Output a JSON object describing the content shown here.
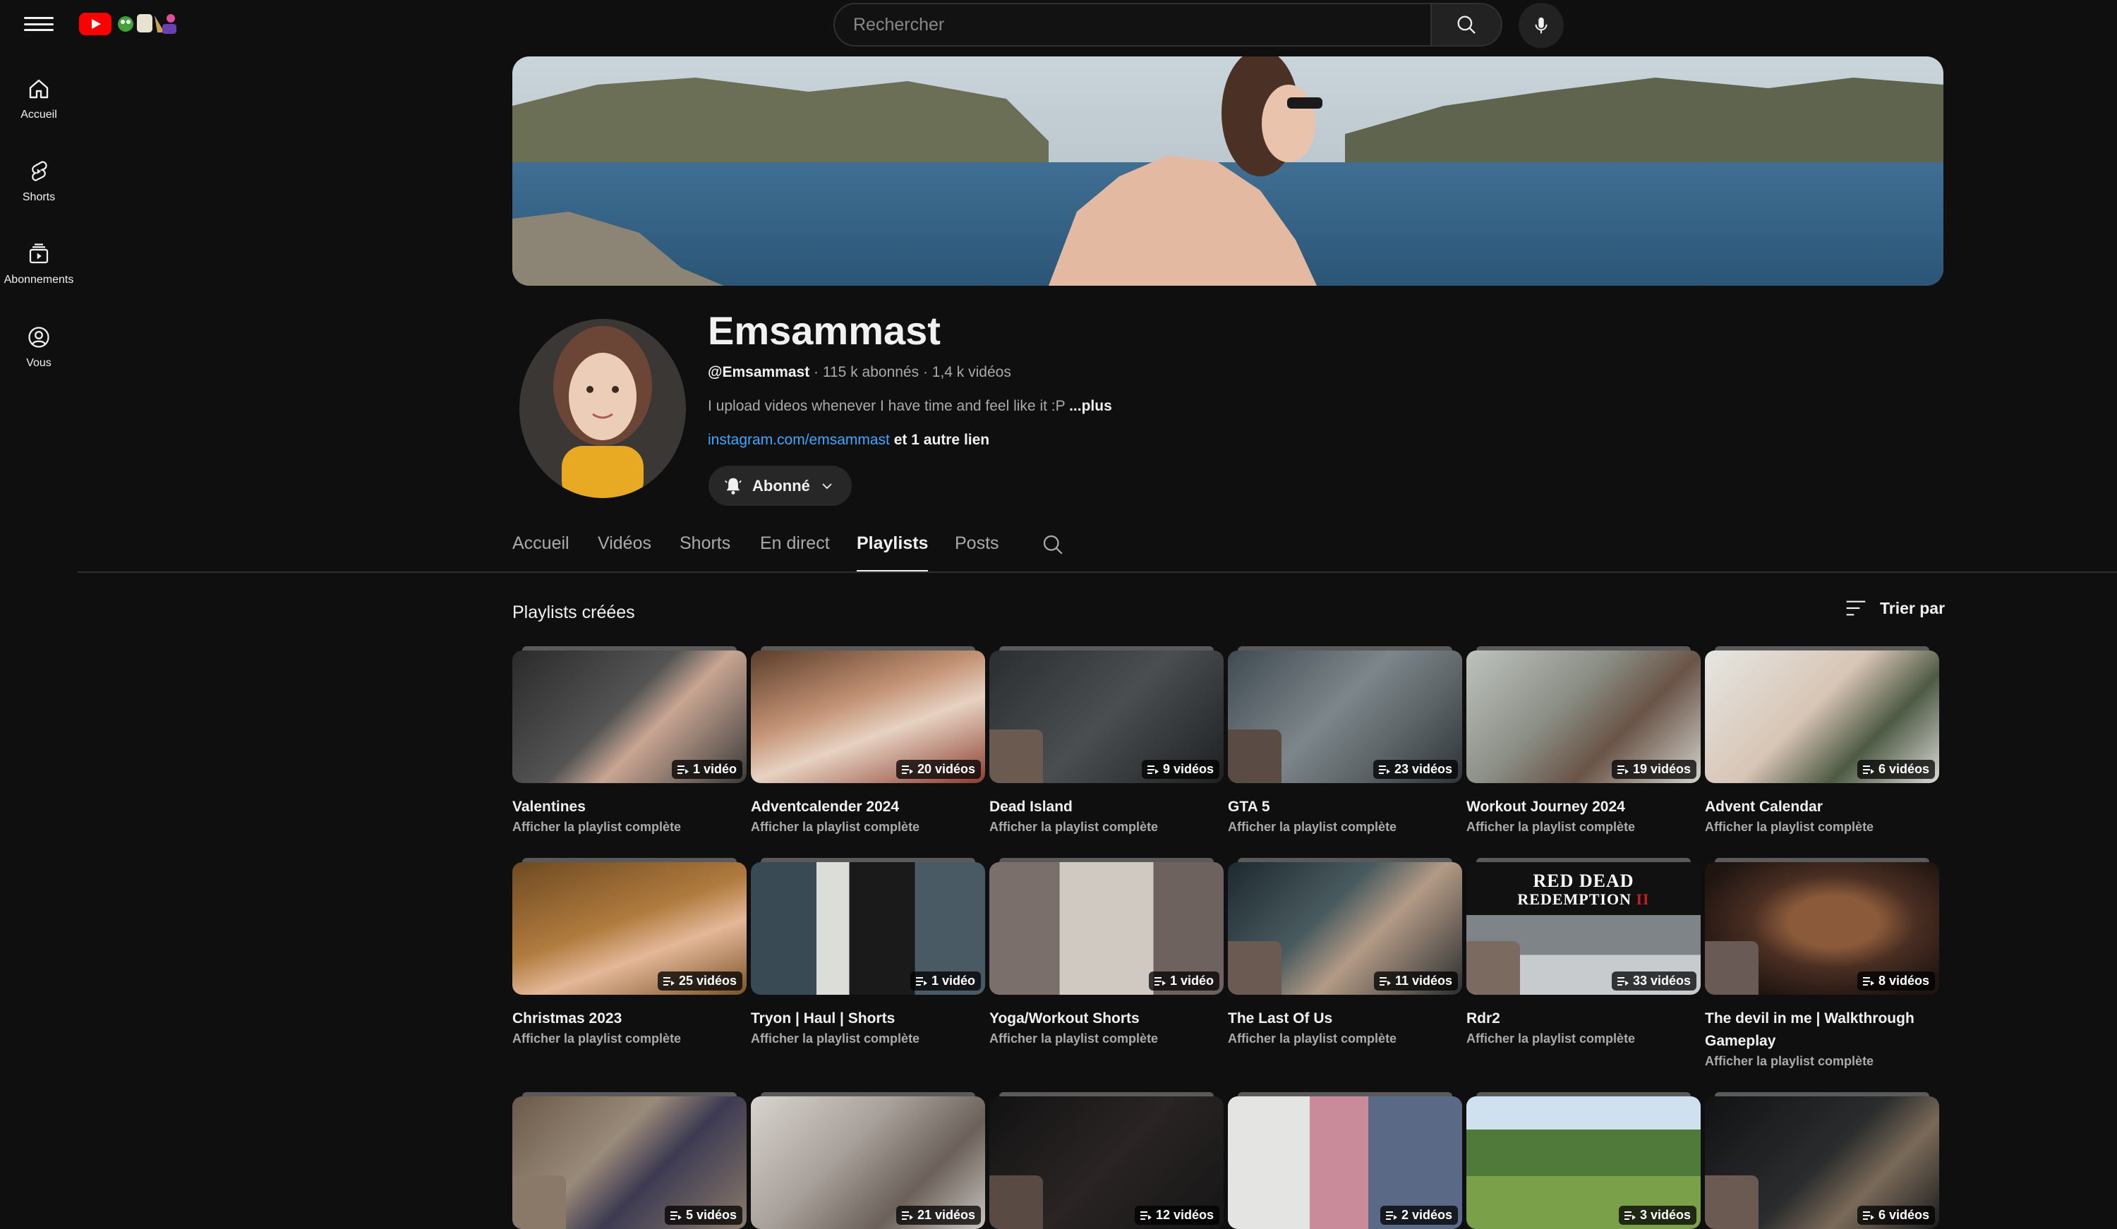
{
  "topbar": {
    "search_placeholder": "Rechercher"
  },
  "sidebar": {
    "items": [
      {
        "label": "Accueil",
        "icon": "home-icon"
      },
      {
        "label": "Shorts",
        "icon": "shorts-icon"
      },
      {
        "label": "Abonnements",
        "icon": "subscriptions-icon"
      },
      {
        "label": "Vous",
        "icon": "account-icon"
      }
    ]
  },
  "channel": {
    "name": "Emsammast",
    "handle": "@Emsammast",
    "stats": " · 115 k abonnés · 1,4 k vidéos",
    "description": "I upload videos whenever I have time and feel like it :P ",
    "more_label": "...plus",
    "link": "instagram.com/emsammast",
    "other_links": " et 1 autre lien",
    "subscribe_label": "Abonné"
  },
  "tabs": [
    {
      "label": "Accueil",
      "active": false
    },
    {
      "label": "Vidéos",
      "active": false
    },
    {
      "label": "Shorts",
      "active": false
    },
    {
      "label": "En direct",
      "active": false
    },
    {
      "label": "Playlists",
      "active": true
    },
    {
      "label": "Posts",
      "active": false
    }
  ],
  "section": {
    "title": "Playlists créées",
    "sort_label": "Trier par"
  },
  "playlists": [
    {
      "title": "Valentines",
      "count": "1 vidéo",
      "sub": "Afficher la playlist complète"
    },
    {
      "title": "Adventcalender 2024",
      "count": "20 vidéos",
      "sub": "Afficher la playlist complète"
    },
    {
      "title": "Dead Island",
      "count": "9 vidéos",
      "sub": "Afficher la playlist complète"
    },
    {
      "title": "GTA 5",
      "count": "23 vidéos",
      "sub": "Afficher la playlist complète"
    },
    {
      "title": "Workout Journey 2024",
      "count": "19 vidéos",
      "sub": "Afficher la playlist complète"
    },
    {
      "title": "Advent Calendar",
      "count": "6 vidéos",
      "sub": "Afficher la playlist complète"
    },
    {
      "title": "Christmas 2023",
      "count": "25 vidéos",
      "sub": "Afficher la playlist complète"
    },
    {
      "title": "Tryon | Haul | Shorts",
      "count": "1 vidéo",
      "sub": "Afficher la playlist complète"
    },
    {
      "title": "Yoga/Workout Shorts",
      "count": "1 vidéo",
      "sub": "Afficher la playlist complète"
    },
    {
      "title": "The Last Of Us",
      "count": "11 vidéos",
      "sub": "Afficher la playlist complète"
    },
    {
      "title": "Rdr2",
      "count": "33 vidéos",
      "sub": "Afficher la playlist complète",
      "thumb_text_1": "RED DEAD",
      "thumb_text_2": "REDEMPTION",
      "thumb_text_3": "II"
    },
    {
      "title": "The devil in me | Walkthrough Gameplay",
      "count": "8 vidéos",
      "sub": "Afficher la playlist complète"
    },
    {
      "title": "",
      "count": "5 vidéos",
      "sub": ""
    },
    {
      "title": "",
      "count": "21 vidéos",
      "sub": ""
    },
    {
      "title": "",
      "count": "12 vidéos",
      "sub": ""
    },
    {
      "title": "",
      "count": "2 vidéos",
      "sub": ""
    },
    {
      "title": "",
      "count": "3 vidéos",
      "sub": ""
    },
    {
      "title": "",
      "count": "6 vidéos",
      "sub": ""
    }
  ],
  "colors": {
    "background": "#0f0f0f",
    "link": "#3ea6ff",
    "brand_red": "#ff0000"
  }
}
